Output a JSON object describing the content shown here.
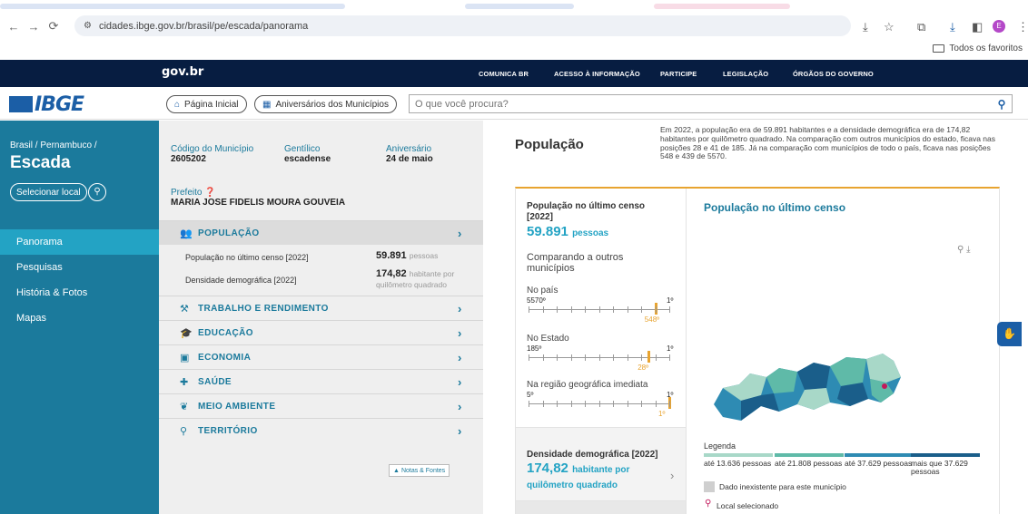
{
  "browser": {
    "url": "cidades.ibge.gov.br/brasil/pe/escada/panorama",
    "profile_initial": "E",
    "bookmarks_folder": "Todos os favoritos"
  },
  "gov_bar": {
    "logo": "gov.br",
    "links": [
      "COMUNICA BR",
      "ACESSO À INFORMAÇÃO",
      "PARTICIPE",
      "LEGISLAÇÃO",
      "ÓRGÃOS DO GOVERNO"
    ]
  },
  "header": {
    "logo": "IBGE",
    "home_button": "Página Inicial",
    "anniversaries_button": "Aniversários dos Municípios",
    "search_placeholder": "O que você procura?"
  },
  "sidebar": {
    "breadcrumb": "Brasil / Pernambuco /",
    "city": "Escada",
    "select_button": "Selecionar local",
    "items": [
      {
        "label": "Panorama",
        "active": true
      },
      {
        "label": "Pesquisas",
        "active": false
      },
      {
        "label": "História & Fotos",
        "active": false
      },
      {
        "label": "Mapas",
        "active": false
      }
    ]
  },
  "municipio": {
    "code_label": "Código do Município",
    "code_value": "2605202",
    "gentilico_label": "Gentílico",
    "gentilico_value": "escadense",
    "aniversario_label": "Aniversário",
    "aniversario_value": "24 de maio",
    "prefeito_label": "Prefeito",
    "prefeito_value": "MARIA JOSE FIDELIS MOURA GOUVEIA"
  },
  "topics": [
    {
      "label": "POPULAÇÃO",
      "icon": "people-icon",
      "active": true
    },
    {
      "label": "TRABALHO E RENDIMENTO",
      "icon": "worker-icon",
      "active": false
    },
    {
      "label": "EDUCAÇÃO",
      "icon": "graduation-icon",
      "active": false
    },
    {
      "label": "ECONOMIA",
      "icon": "money-icon",
      "active": false
    },
    {
      "label": "SAÚDE",
      "icon": "health-icon",
      "active": false
    },
    {
      "label": "MEIO AMBIENTE",
      "icon": "leaf-icon",
      "active": false
    },
    {
      "label": "TERRITÓRIO",
      "icon": "pin-icon",
      "active": false
    }
  ],
  "population_rows": [
    {
      "label": "População no último censo [2022]",
      "value": "59.891",
      "unit": "pessoas"
    },
    {
      "label": "Densidade demográfica [2022]",
      "value": "174,82",
      "unit": "habitante por quilômetro quadrado"
    }
  ],
  "notes_button": "Notas & Fontes",
  "content": {
    "title": "População",
    "description": "Em 2022, a população era de 59.891 habitantes e a densidade demográfica era de 174,82 habitantes por quilômetro quadrado. Na comparação com outros municípios do estado, ficava nas posições 28 e 41 de 185. Já na comparação com municípios de todo o país, ficava nas posições 548 e 439 de 5570.",
    "card": {
      "title": "População no último censo [2022]",
      "value": "59.891",
      "unit": "pessoas",
      "compare_title": "Comparando a outros municípios",
      "rankings": [
        {
          "label": "No país",
          "min": "5570º",
          "max": "1º",
          "pos": "548º",
          "fraction": 0.902
        },
        {
          "label": "No Estado",
          "min": "185º",
          "max": "1º",
          "pos": "28º",
          "fraction": 0.853
        },
        {
          "label": "Na região geográfica imediata",
          "min": "5º",
          "max": "1º",
          "pos": "1º",
          "fraction": 1.0
        }
      ],
      "density": {
        "title": "Densidade demográfica [2022]",
        "value": "174,82",
        "unit": "habitante por quilômetro quadrado"
      },
      "map_title": "População no último censo",
      "legend": {
        "title": "Legenda",
        "classes": [
          {
            "label": "até 13.636 pessoas",
            "color": "#a8d8c8"
          },
          {
            "label": "até 21.808 pessoas",
            "color": "#5fbaa8"
          },
          {
            "label": "até 37.629 pessoas",
            "color": "#2e8bb3"
          },
          {
            "label": "mais que 37.629 pessoas",
            "color": "#1a5e8a"
          }
        ],
        "no_data": "Dado inexistente para este município",
        "selected": "Local selecionado"
      }
    }
  }
}
